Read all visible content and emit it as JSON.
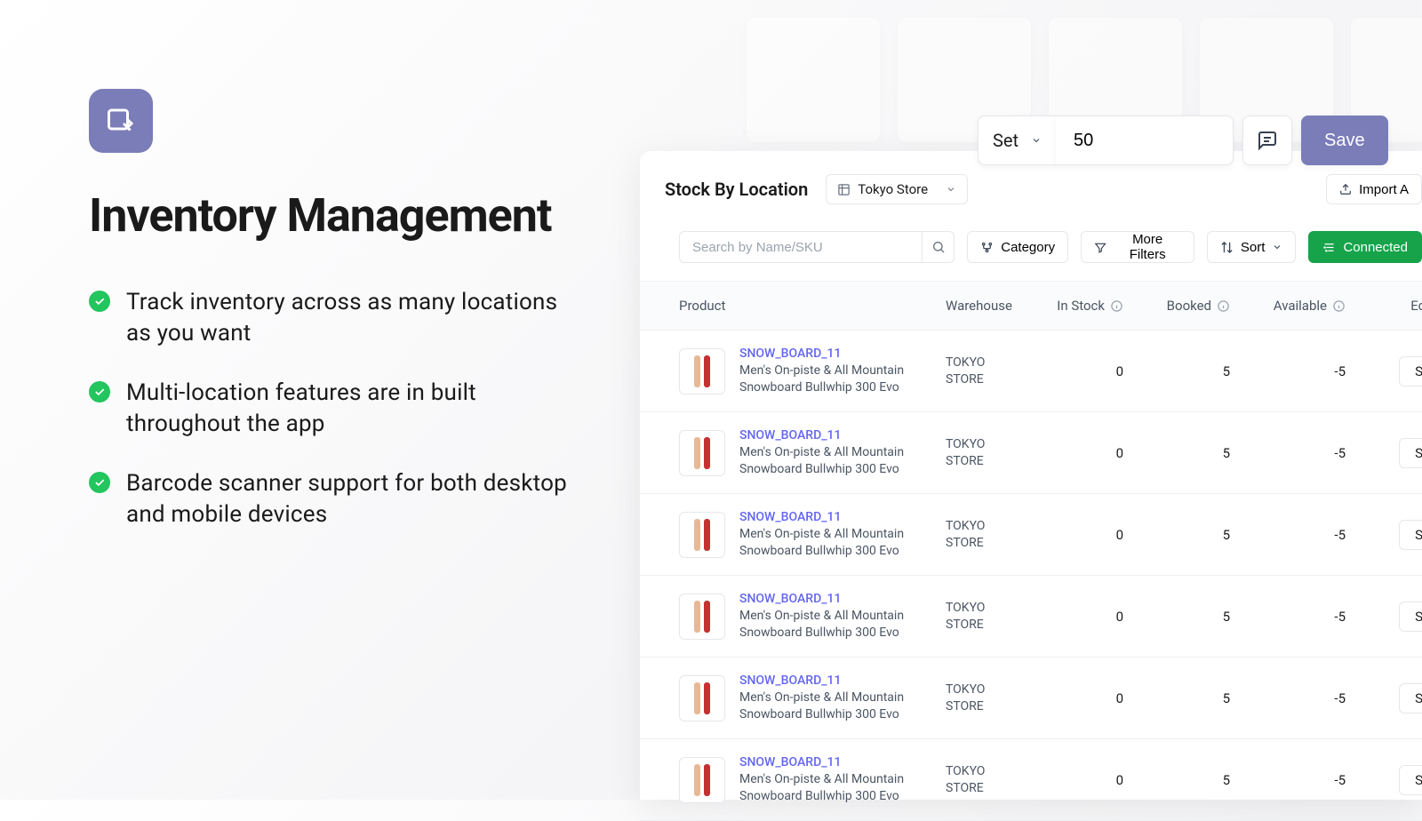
{
  "left": {
    "headline": "Inventory Management",
    "features": [
      "Track inventory across as many locations as you want",
      "Multi-location features are in built throughout the app",
      "Barcode scanner support for both desktop and mobile devices"
    ]
  },
  "floating": {
    "set_label": "Set",
    "value": "50",
    "save_label": "Save"
  },
  "section": {
    "title": "Stock By Location",
    "store": "Tokyo Store",
    "import_label": "Import A"
  },
  "toolbar": {
    "search_placeholder": "Search by Name/SKU",
    "category_label": "Category",
    "filters_label": "More Filters",
    "sort_label": "Sort",
    "connected_label": "Connected"
  },
  "table": {
    "columns": {
      "product": "Product",
      "warehouse": "Warehouse",
      "in_stock": "In Stock",
      "booked": "Booked",
      "available": "Available",
      "edit_stock": "Edit Stock"
    },
    "rows": [
      {
        "sku": "SNOW_BOARD_11",
        "name": "Men's On-piste & All Mountain Snowboard Bullwhip 300 Evo",
        "warehouse": "TOKYO STORE",
        "in_stock": "0",
        "booked": "5",
        "available": "-5",
        "action": "Set"
      },
      {
        "sku": "SNOW_BOARD_11",
        "name": "Men's On-piste & All Mountain Snowboard Bullwhip 300 Evo",
        "warehouse": "TOKYO STORE",
        "in_stock": "0",
        "booked": "5",
        "available": "-5",
        "action": "Set"
      },
      {
        "sku": "SNOW_BOARD_11",
        "name": "Men's On-piste & All Mountain Snowboard Bullwhip 300 Evo",
        "warehouse": "TOKYO STORE",
        "in_stock": "0",
        "booked": "5",
        "available": "-5",
        "action": "Set"
      },
      {
        "sku": "SNOW_BOARD_11",
        "name": "Men's On-piste & All Mountain Snowboard Bullwhip 300 Evo",
        "warehouse": "TOKYO STORE",
        "in_stock": "0",
        "booked": "5",
        "available": "-5",
        "action": "Set"
      },
      {
        "sku": "SNOW_BOARD_11",
        "name": "Men's On-piste & All Mountain Snowboard Bullwhip 300 Evo",
        "warehouse": "TOKYO STORE",
        "in_stock": "0",
        "booked": "5",
        "available": "-5",
        "action": "Set"
      },
      {
        "sku": "SNOW_BOARD_11",
        "name": "Men's On-piste & All Mountain Snowboard Bullwhip 300 Evo",
        "warehouse": "TOKYO STORE",
        "in_stock": "0",
        "booked": "5",
        "available": "-5",
        "action": "Set"
      }
    ]
  }
}
